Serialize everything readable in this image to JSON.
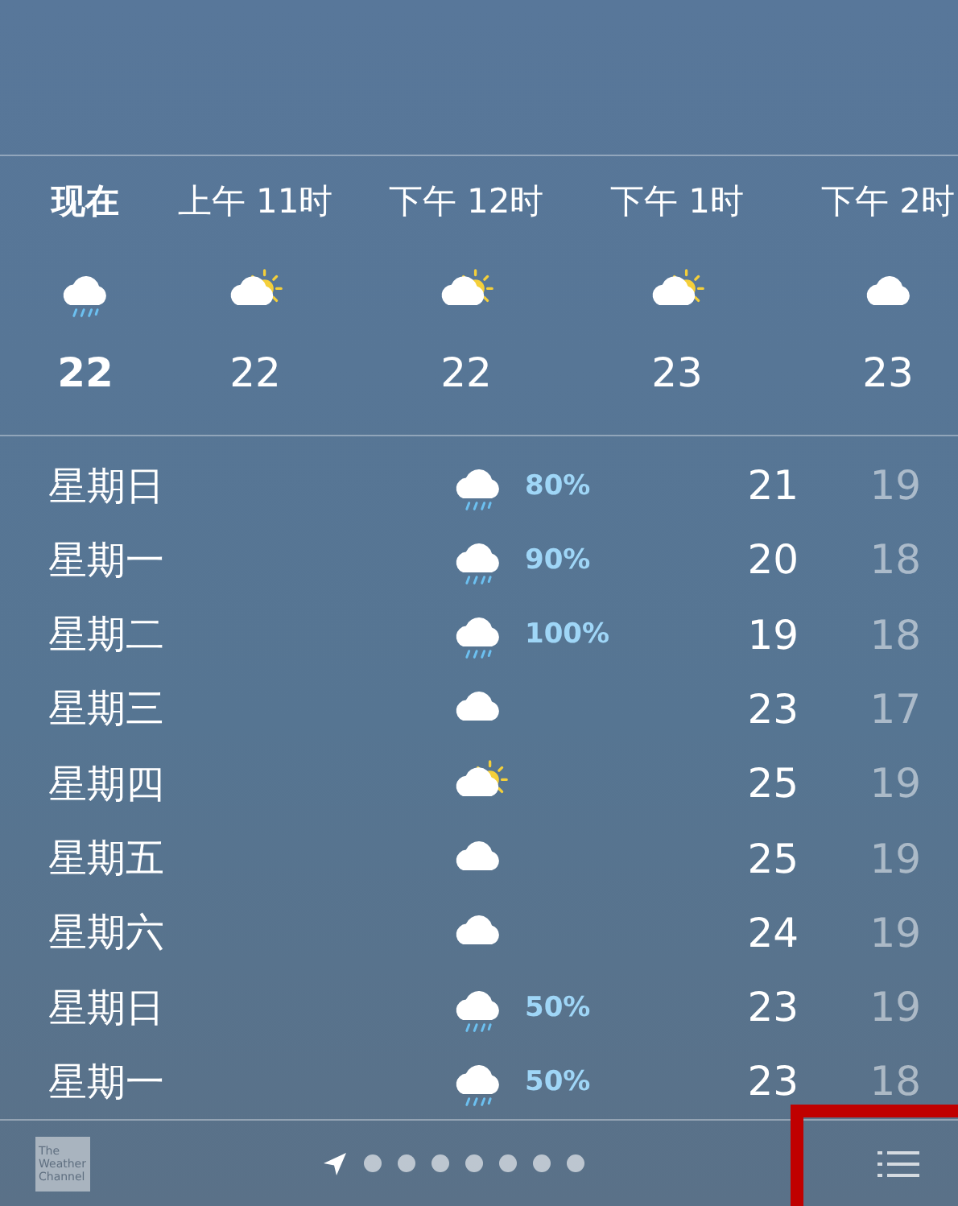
{
  "hourly": [
    {
      "time": "现在",
      "kind": "rain",
      "temp": "22",
      "current": true
    },
    {
      "time": "上午 11时",
      "kind": "partly",
      "temp": "22",
      "current": false
    },
    {
      "time": "下午 12时",
      "kind": "partly",
      "temp": "22",
      "current": false
    },
    {
      "time": "下午 1时",
      "kind": "partly",
      "temp": "23",
      "current": false
    },
    {
      "time": "下午 2时",
      "kind": "cloud",
      "temp": "23",
      "current": false
    }
  ],
  "daily": [
    {
      "day": "星期日",
      "kind": "rain",
      "chance": "80%",
      "high": "21",
      "low": "19"
    },
    {
      "day": "星期一",
      "kind": "rain",
      "chance": "90%",
      "high": "20",
      "low": "18"
    },
    {
      "day": "星期二",
      "kind": "rain",
      "chance": "100%",
      "high": "19",
      "low": "18"
    },
    {
      "day": "星期三",
      "kind": "cloud",
      "high": "23",
      "low": "17"
    },
    {
      "day": "星期四",
      "kind": "partly",
      "high": "25",
      "low": "19"
    },
    {
      "day": "星期五",
      "kind": "cloud",
      "high": "25",
      "low": "19"
    },
    {
      "day": "星期六",
      "kind": "cloud",
      "high": "24",
      "low": "19"
    },
    {
      "day": "星期日",
      "kind": "rain",
      "chance": "50%",
      "high": "23",
      "low": "19"
    },
    {
      "day": "星期一",
      "kind": "rain",
      "chance": "50%",
      "high": "23",
      "low": "18"
    }
  ],
  "footer": {
    "logo_text": [
      "The",
      "Weather",
      "Channel"
    ],
    "pages": [
      {
        "kind": "location"
      },
      {
        "kind": "dot"
      },
      {
        "kind": "dot"
      },
      {
        "kind": "dot"
      },
      {
        "kind": "dot"
      },
      {
        "kind": "dot"
      },
      {
        "kind": "dot"
      },
      {
        "kind": "dot"
      }
    ],
    "list_button_highlighted": true
  }
}
